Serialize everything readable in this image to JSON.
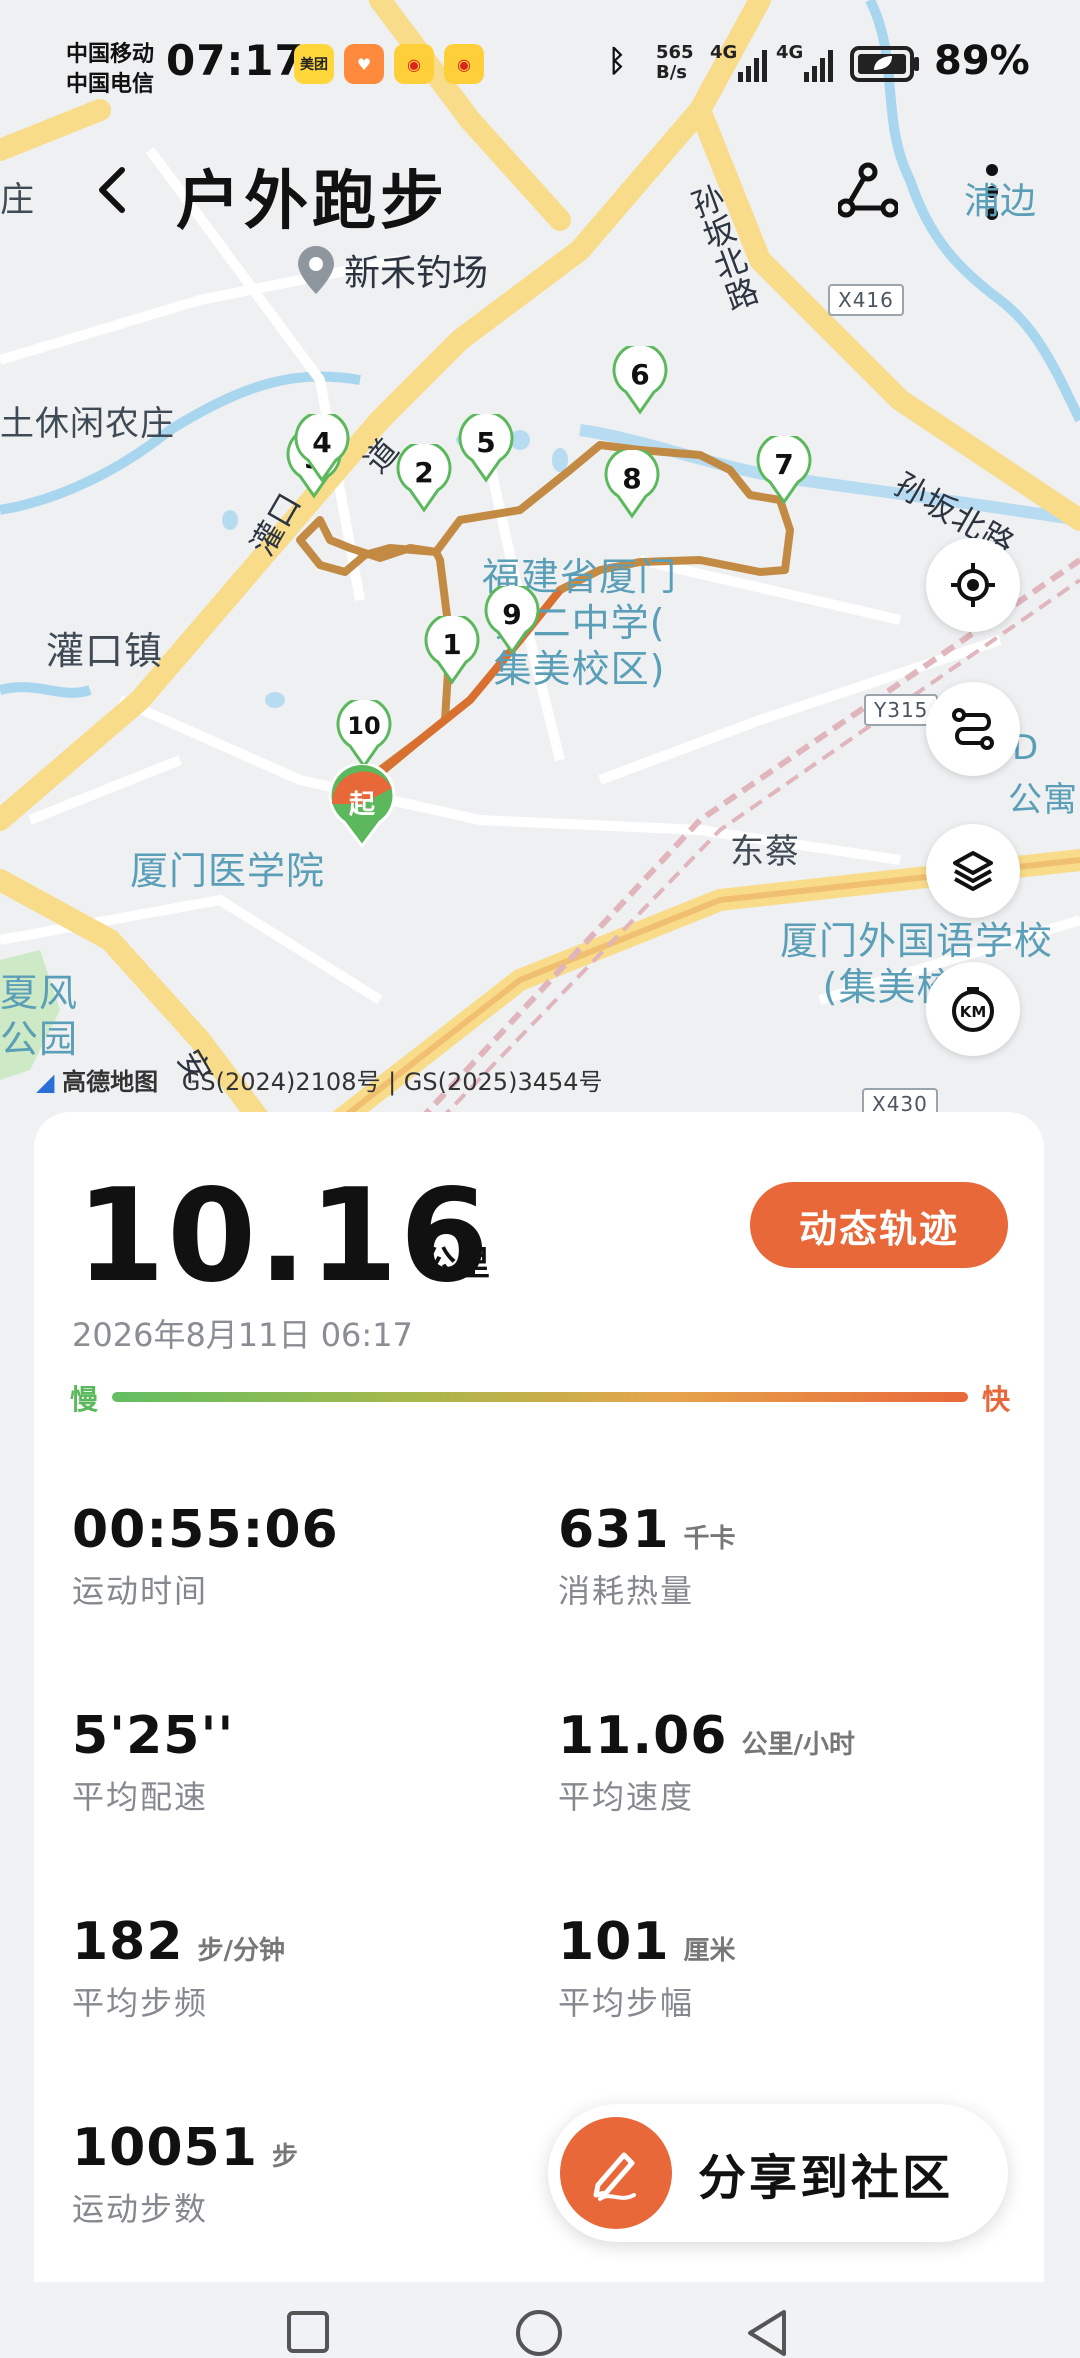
{
  "status_bar": {
    "carrier1": "中国移动",
    "carrier2": "中国电信",
    "time": "07:17",
    "app_meituan": "美团",
    "net_speed_top": "565",
    "net_speed_bottom": "B/s",
    "sig1": "4G",
    "sig2": "4G",
    "battery": "89%"
  },
  "header": {
    "title": "户外跑步",
    "location": "新禾钓场",
    "corner_text": "浦边"
  },
  "map": {
    "labels": {
      "village": "土休闲农庄",
      "town": "灌口镇",
      "school": "福建省厦门第二中学(集美校区)",
      "school_line1": "福建省厦门",
      "school_line2": "第二中学(",
      "school_line3": "集美校区)",
      "medical": "厦门医学院",
      "dongcai": "东蔡",
      "foreign": "厦门外国语学校",
      "foreign_line2": "(集美校区)",
      "road_sunban_v": "孙坂北路",
      "road_sunban_h": "孙坂北路",
      "road_guankou": "灌口",
      "road_dao": "道",
      "road_an": "安",
      "left_park": "夏风公园",
      "left_park_1": "夏风",
      "left_park_2": "公园",
      "right_edge1": "D",
      "right_edge2": "公寓",
      "left_edge": "庄",
      "tag_x416": "X416",
      "tag_y315": "Y315",
      "tag_x430": "X430"
    },
    "km_markers": [
      "1",
      "2",
      "3",
      "4",
      "5",
      "6",
      "7",
      "8",
      "9",
      "10"
    ],
    "start_label": "起",
    "credit_brand": "高德地图",
    "credit_text": "GS(2024)2108号 | GS(2025)3454号"
  },
  "summary": {
    "distance": "10.16",
    "distance_unit": "公里",
    "dynamic_button": "动态轨迹",
    "datetime": "2026年8月11日 06:17",
    "slow": "慢",
    "fast": "快"
  },
  "stats": [
    {
      "value": "00:55:06",
      "unit": "",
      "label": "运动时间"
    },
    {
      "value": "631",
      "unit": "千卡",
      "label": "消耗热量"
    },
    {
      "value": "5'25''",
      "unit": "",
      "label": "平均配速"
    },
    {
      "value": "11.06",
      "unit": "公里/小时",
      "label": "平均速度"
    },
    {
      "value": "182",
      "unit": "步/分钟",
      "label": "平均步频"
    },
    {
      "value": "101",
      "unit": "厘米",
      "label": "平均步幅"
    },
    {
      "value": "10051",
      "unit": "步",
      "label": "运动步数"
    }
  ],
  "share": {
    "label": "分享到社区"
  },
  "icons": {
    "back": "back-arrow-icon",
    "route": "route-share-icon",
    "more": "more-vertical-icon",
    "locate": "locate-icon",
    "path": "route-toggle-icon",
    "layers": "layers-icon",
    "km": "km-marker-icon",
    "pen": "pen-icon"
  },
  "colors": {
    "accent": "#e8683a",
    "slow": "#5cb85c",
    "route": "#c0843a",
    "marker_green": "#5cb85c"
  }
}
